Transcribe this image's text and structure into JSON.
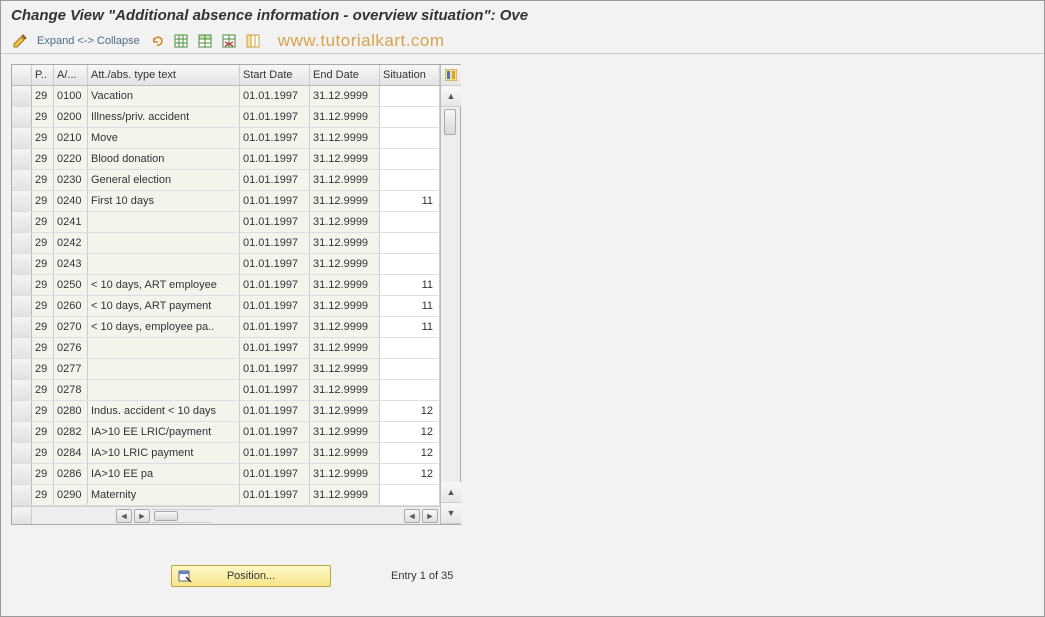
{
  "title": "Change View \"Additional absence information - overview situation\": Ove",
  "toolbar": {
    "expand_collapse": "Expand <-> Collapse"
  },
  "watermark": "www.tutorialkart.com",
  "table": {
    "headers": {
      "p": "P..",
      "a": "A/...",
      "text": "Att./abs. type text",
      "start": "Start Date",
      "end": "End Date",
      "situation": "Situation"
    },
    "rows": [
      {
        "p": "29",
        "a": "0100",
        "text": "Vacation",
        "start": "01.01.1997",
        "end": "31.12.9999",
        "sit": ""
      },
      {
        "p": "29",
        "a": "0200",
        "text": "Illness/priv. accident",
        "start": "01.01.1997",
        "end": "31.12.9999",
        "sit": ""
      },
      {
        "p": "29",
        "a": "0210",
        "text": "Move",
        "start": "01.01.1997",
        "end": "31.12.9999",
        "sit": ""
      },
      {
        "p": "29",
        "a": "0220",
        "text": "Blood donation",
        "start": "01.01.1997",
        "end": "31.12.9999",
        "sit": ""
      },
      {
        "p": "29",
        "a": "0230",
        "text": "General election",
        "start": "01.01.1997",
        "end": "31.12.9999",
        "sit": ""
      },
      {
        "p": "29",
        "a": "0240",
        "text": "First 10 days",
        "start": "01.01.1997",
        "end": "31.12.9999",
        "sit": "11"
      },
      {
        "p": "29",
        "a": "0241",
        "text": "",
        "start": "01.01.1997",
        "end": "31.12.9999",
        "sit": ""
      },
      {
        "p": "29",
        "a": "0242",
        "text": "",
        "start": "01.01.1997",
        "end": "31.12.9999",
        "sit": ""
      },
      {
        "p": "29",
        "a": "0243",
        "text": "",
        "start": "01.01.1997",
        "end": "31.12.9999",
        "sit": ""
      },
      {
        "p": "29",
        "a": "0250",
        "text": "< 10 days, ART employee",
        "start": "01.01.1997",
        "end": "31.12.9999",
        "sit": "11"
      },
      {
        "p": "29",
        "a": "0260",
        "text": "< 10 days, ART payment",
        "start": "01.01.1997",
        "end": "31.12.9999",
        "sit": "11"
      },
      {
        "p": "29",
        "a": "0270",
        "text": "< 10 days, employee pa..",
        "start": "01.01.1997",
        "end": "31.12.9999",
        "sit": "11"
      },
      {
        "p": "29",
        "a": "0276",
        "text": "",
        "start": "01.01.1997",
        "end": "31.12.9999",
        "sit": ""
      },
      {
        "p": "29",
        "a": "0277",
        "text": "",
        "start": "01.01.1997",
        "end": "31.12.9999",
        "sit": ""
      },
      {
        "p": "29",
        "a": "0278",
        "text": "",
        "start": "01.01.1997",
        "end": "31.12.9999",
        "sit": ""
      },
      {
        "p": "29",
        "a": "0280",
        "text": "Indus. accident < 10 days",
        "start": "01.01.1997",
        "end": "31.12.9999",
        "sit": "12"
      },
      {
        "p": "29",
        "a": "0282",
        "text": "IA>10 EE LRIC/payment",
        "start": "01.01.1997",
        "end": "31.12.9999",
        "sit": "12"
      },
      {
        "p": "29",
        "a": "0284",
        "text": "IA>10 LRIC payment",
        "start": "01.01.1997",
        "end": "31.12.9999",
        "sit": "12"
      },
      {
        "p": "29",
        "a": "0286",
        "text": "IA>10 EE pa",
        "start": "01.01.1997",
        "end": "31.12.9999",
        "sit": "12"
      },
      {
        "p": "29",
        "a": "0290",
        "text": "Maternity",
        "start": "01.01.1997",
        "end": "31.12.9999",
        "sit": ""
      }
    ]
  },
  "footer": {
    "position_label": "Position...",
    "entry_text": "Entry 1 of 35"
  }
}
